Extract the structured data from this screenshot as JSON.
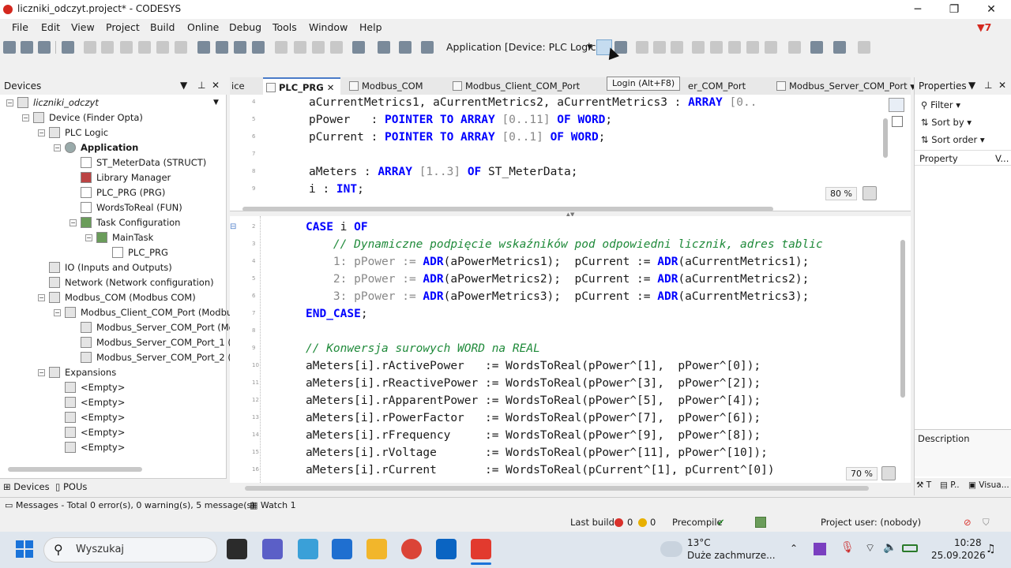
{
  "window": {
    "title": "liczniki_odczyt.project* - CODESYS",
    "minimize": "─",
    "maximize": "❐",
    "close": "✕"
  },
  "menu": [
    "File",
    "Edit",
    "View",
    "Project",
    "Build",
    "Online",
    "Debug",
    "Tools",
    "Window",
    "Help"
  ],
  "notification_count": "7",
  "toolbar": {
    "application_combo": "Application [Device: PLC Logic]",
    "login_tooltip": "Login (Alt+F8)"
  },
  "devices_panel": {
    "title": "Devices",
    "tree": [
      {
        "label": "liczniki_odczyt",
        "level": 0,
        "icon": "project-icon"
      },
      {
        "label": "Device (Finder Opta)",
        "level": 1,
        "icon": "device-icon"
      },
      {
        "label": "PLC Logic",
        "level": 2,
        "icon": "plc-logic-icon"
      },
      {
        "label": "Application",
        "level": 3,
        "icon": "application-gear-icon"
      },
      {
        "label": "ST_MeterData (STRUCT)",
        "level": 4,
        "icon": "struct-icon"
      },
      {
        "label": "Library Manager",
        "level": 4,
        "icon": "library-icon"
      },
      {
        "label": "PLC_PRG (PRG)",
        "level": 4,
        "icon": "program-icon"
      },
      {
        "label": "WordsToReal (FUN)",
        "level": 4,
        "icon": "function-icon"
      },
      {
        "label": "Task Configuration",
        "level": 4,
        "icon": "task-config-icon"
      },
      {
        "label": "MainTask",
        "level": 5,
        "icon": "task-icon"
      },
      {
        "label": "PLC_PRG",
        "level": 6,
        "icon": "program-icon"
      },
      {
        "label": "IO (Inputs and Outputs)",
        "level": 2,
        "icon": "io-icon"
      },
      {
        "label": "Network (Network configuration)",
        "level": 2,
        "icon": "network-icon"
      },
      {
        "label": "Modbus_COM (Modbus COM)",
        "level": 2,
        "icon": "modbus-icon"
      },
      {
        "label": "Modbus_Client_COM_Port (Modbus Cli",
        "level": 3,
        "icon": "modbus-icon"
      },
      {
        "label": "Modbus_Server_COM_Port (Modb",
        "level": 4,
        "icon": "modbus-icon"
      },
      {
        "label": "Modbus_Server_COM_Port_1 (Mo",
        "level": 4,
        "icon": "modbus-icon"
      },
      {
        "label": "Modbus_Server_COM_Port_2 (Mo",
        "level": 4,
        "icon": "modbus-icon"
      },
      {
        "label": "Expansions",
        "level": 2,
        "icon": "expansions-icon"
      },
      {
        "label": "<Empty>",
        "level": 3,
        "icon": "empty-slot-icon"
      },
      {
        "label": "<Empty>",
        "level": 3,
        "icon": "empty-slot-icon"
      },
      {
        "label": "<Empty>",
        "level": 3,
        "icon": "empty-slot-icon"
      },
      {
        "label": "<Empty>",
        "level": 3,
        "icon": "empty-slot-icon"
      },
      {
        "label": "<Empty>",
        "level": 3,
        "icon": "empty-slot-icon"
      }
    ],
    "tabs": [
      "Devices",
      "POUs"
    ]
  },
  "editor_tabs": [
    {
      "label": "ice",
      "active": false
    },
    {
      "label": "PLC_PRG",
      "active": true
    },
    {
      "label": "Modbus_COM",
      "active": false
    },
    {
      "label": "Modbus_Client_COM_Port",
      "active": false
    },
    {
      "label": "er_COM_Port",
      "active": false
    },
    {
      "label": "Modbus_Server_COM_Port",
      "active": false
    }
  ],
  "declaration": {
    "zoom": "80 %",
    "line_numbers": [
      "4",
      "5",
      "6",
      "7",
      "8",
      "9"
    ],
    "lines": [
      [
        {
          "t": "aCurrentMetrics1, aCurrentMetrics2, aCurrentMetrics3 : ",
          "c": ""
        },
        {
          "t": "ARRAY",
          "c": "kw"
        },
        {
          "t": " [0..",
          "c": "num"
        }
      ],
      [
        {
          "t": "pPower   : ",
          "c": ""
        },
        {
          "t": "POINTER TO ARRAY",
          "c": "kw"
        },
        {
          "t": " [0..11] ",
          "c": "num"
        },
        {
          "t": "OF WORD",
          "c": "kw"
        },
        {
          "t": ";",
          "c": ""
        }
      ],
      [
        {
          "t": "pCurrent : ",
          "c": ""
        },
        {
          "t": "POINTER TO ARRAY",
          "c": "kw"
        },
        {
          "t": " [0..1] ",
          "c": "num"
        },
        {
          "t": "OF WORD",
          "c": "kw"
        },
        {
          "t": ";",
          "c": ""
        }
      ],
      [
        {
          "t": "",
          "c": ""
        }
      ],
      [
        {
          "t": "aMeters : ",
          "c": ""
        },
        {
          "t": "ARRAY",
          "c": "kw"
        },
        {
          "t": " [1..3] ",
          "c": "num"
        },
        {
          "t": "OF",
          "c": "kw"
        },
        {
          "t": " ST_MeterData;",
          "c": ""
        }
      ],
      [
        {
          "t": "i : ",
          "c": ""
        },
        {
          "t": "INT",
          "c": "kw"
        },
        {
          "t": ";",
          "c": ""
        }
      ]
    ]
  },
  "implementation": {
    "zoom": "70 %",
    "line_numbers": [
      "2",
      "3",
      "4",
      "5",
      "6",
      "7",
      "8",
      "9",
      "10",
      "11",
      "12",
      "13",
      "14",
      "15",
      "16"
    ],
    "lines": [
      [
        {
          "t": "CASE",
          "c": "kw"
        },
        {
          "t": " i ",
          "c": ""
        },
        {
          "t": "OF",
          "c": "kw"
        }
      ],
      [
        {
          "t": "    // Dynamiczne podpięcie wskaźników pod odpowiedni licznik, adres tablic",
          "c": "cm"
        }
      ],
      [
        {
          "t": "    1: pPower := ",
          "c": "num"
        },
        {
          "t": "ADR",
          "c": "kw"
        },
        {
          "t": "(aPowerMetrics1);  pCurrent := ",
          "c": ""
        },
        {
          "t": "ADR",
          "c": "kw"
        },
        {
          "t": "(aCurrentMetrics1);",
          "c": ""
        }
      ],
      [
        {
          "t": "    2: pPower := ",
          "c": "num"
        },
        {
          "t": "ADR",
          "c": "kw"
        },
        {
          "t": "(aPowerMetrics2);  pCurrent := ",
          "c": ""
        },
        {
          "t": "ADR",
          "c": "kw"
        },
        {
          "t": "(aCurrentMetrics2);",
          "c": ""
        }
      ],
      [
        {
          "t": "    3: pPower := ",
          "c": "num"
        },
        {
          "t": "ADR",
          "c": "kw"
        },
        {
          "t": "(aPowerMetrics3);  pCurrent := ",
          "c": ""
        },
        {
          "t": "ADR",
          "c": "kw"
        },
        {
          "t": "(aCurrentMetrics3);",
          "c": ""
        }
      ],
      [
        {
          "t": "END_CASE",
          "c": "kw"
        },
        {
          "t": ";",
          "c": ""
        }
      ],
      [
        {
          "t": "",
          "c": ""
        }
      ],
      [
        {
          "t": "// Konwersja surowych WORD na REAL",
          "c": "cm"
        }
      ],
      [
        {
          "t": "aMeters[i].rActivePower   := WordsToReal(pPower^[1],  pPower^[0]);",
          "c": ""
        }
      ],
      [
        {
          "t": "aMeters[i].rReactivePower := WordsToReal(pPower^[3],  pPower^[2]);",
          "c": ""
        }
      ],
      [
        {
          "t": "aMeters[i].rApparentPower := WordsToReal(pPower^[5],  pPower^[4]);",
          "c": ""
        }
      ],
      [
        {
          "t": "aMeters[i].rPowerFactor   := WordsToReal(pPower^[7],  pPower^[6]);",
          "c": ""
        }
      ],
      [
        {
          "t": "aMeters[i].rFrequency     := WordsToReal(pPower^[9],  pPower^[8]);",
          "c": ""
        }
      ],
      [
        {
          "t": "aMeters[i].rVoltage       := WordsToReal(pPower^[11], pPower^[10]);",
          "c": ""
        }
      ],
      [
        {
          "t": "aMeters[i].rCurrent       := WordsToReal(pCurrent^[1], pCurrent^[0])",
          "c": ""
        }
      ]
    ]
  },
  "properties_panel": {
    "title": "Properties",
    "filter": "Filter",
    "sort_by": "Sort by",
    "sort_order": "Sort order",
    "col_property": "Property",
    "col_value": "V...",
    "description": "Description",
    "tabs": [
      "T",
      "P..",
      "Visua..."
    ]
  },
  "messages_bar": {
    "messages": "Messages - Total 0 error(s), 0 warning(s), 5 message(s)",
    "watch": "Watch 1"
  },
  "status": {
    "last_build": "Last build:",
    "errors": "0",
    "warnings": "0",
    "precompile": "Precompile",
    "project_user": "Project user: (nobody)"
  },
  "taskbar": {
    "search_placeholder": "Wyszukaj",
    "weather_temp": "13°C",
    "weather_desc": "Duże zachmurze...",
    "time": "10:28",
    "date": "25.09.2026"
  },
  "colors": {
    "keyword": "#0000ff",
    "comment": "#1f8a3a",
    "accent": "#4a7bc8"
  }
}
